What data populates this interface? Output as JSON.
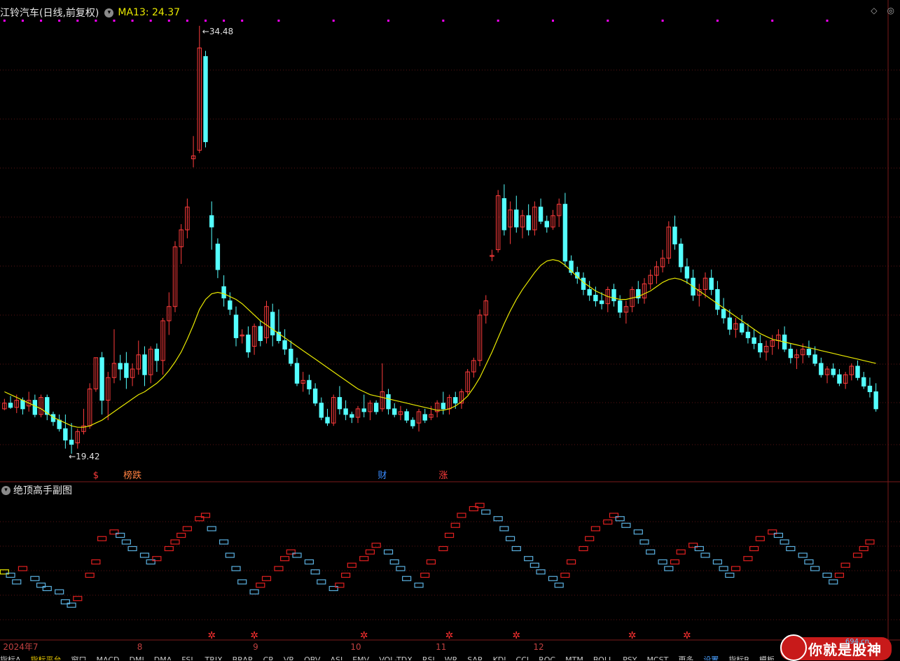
{
  "header": {
    "title": "江铃汽车(日线,前复权)",
    "ma_label": "MA13: 24.37"
  },
  "subpanel": {
    "title": "绝顶高手副图"
  },
  "toolbar": {
    "items": [
      "指标A",
      "指标平台",
      "窗口",
      "MACD",
      "DMI",
      "DMA",
      "FSL",
      "TRIX",
      "BRAR",
      "CR",
      "VR",
      "OBV",
      "ASI",
      "EMV",
      "VOL-TDX",
      "RSI",
      "WR",
      "SAR",
      "KDJ",
      "CCI",
      "ROC",
      "MTM",
      "BOLL",
      "PSY",
      "MCST",
      "更多",
      "设置",
      "指标B",
      "模板"
    ]
  },
  "watermark": {
    "brand": "你就是股神",
    "url": "694.cn"
  },
  "colors": {
    "up": "#ff3c3c",
    "down": "#54ffff",
    "ma": "#e8e800",
    "grid": "#5a1414",
    "sub_up": "#e02020",
    "sub_down": "#5bb0e0",
    "sub_mid": "#e8e800",
    "marker": "#ff00ff"
  },
  "chart_data": {
    "type": "candlestick",
    "title": "江铃汽车(日线,前复权)",
    "ma_label": "MA13",
    "ma_value": 24.37,
    "high_label": "34.48",
    "low_label": "19.42",
    "ylim": [
      19.0,
      34.6
    ],
    "x_labels": [
      "2024年7",
      "8",
      "9",
      "10",
      "11",
      "12"
    ],
    "event_tags": [
      {
        "label": "$",
        "index": 15,
        "color": "#ff3c3c"
      },
      {
        "label": "榜跌",
        "index": 21,
        "color": "#ff8040"
      },
      {
        "label": "财",
        "index": 62,
        "color": "#3a8cff"
      },
      {
        "label": "涨",
        "index": 72,
        "color": "#ff3c3c"
      }
    ],
    "ohlc": [
      [
        21.0,
        21.35,
        20.95,
        21.2
      ],
      [
        21.2,
        21.45,
        21.0,
        21.05
      ],
      [
        21.05,
        21.5,
        20.85,
        21.3
      ],
      [
        21.3,
        21.4,
        20.8,
        21.0
      ],
      [
        21.1,
        21.6,
        20.9,
        21.3
      ],
      [
        21.3,
        21.5,
        20.7,
        20.8
      ],
      [
        20.8,
        21.5,
        20.7,
        21.4
      ],
      [
        21.4,
        21.5,
        20.6,
        20.8
      ],
      [
        20.8,
        20.9,
        20.4,
        20.55
      ],
      [
        20.6,
        20.8,
        20.2,
        20.3
      ],
      [
        20.3,
        20.8,
        19.6,
        19.9
      ],
      [
        19.9,
        20.5,
        19.42,
        19.75
      ],
      [
        19.8,
        20.3,
        19.6,
        20.2
      ],
      [
        20.2,
        21.0,
        20.1,
        20.4
      ],
      [
        20.4,
        21.9,
        20.3,
        21.7
      ],
      [
        21.7,
        22.8,
        21.6,
        22.8
      ],
      [
        22.8,
        23.0,
        20.8,
        21.3
      ],
      [
        21.3,
        22.3,
        20.6,
        22.1
      ],
      [
        22.1,
        23.8,
        21.9,
        22.6
      ],
      [
        22.6,
        22.9,
        22.0,
        22.4
      ],
      [
        22.6,
        23.0,
        21.7,
        22.1
      ],
      [
        22.1,
        22.6,
        21.8,
        22.4
      ],
      [
        22.4,
        23.4,
        22.2,
        22.9
      ],
      [
        22.9,
        23.2,
        21.8,
        22.2
      ],
      [
        22.2,
        23.2,
        21.9,
        23.1
      ],
      [
        23.1,
        23.3,
        22.3,
        22.7
      ],
      [
        22.7,
        24.2,
        22.2,
        24.1
      ],
      [
        24.1,
        25.1,
        23.6,
        24.6
      ],
      [
        24.6,
        26.9,
        24.4,
        26.7
      ],
      [
        26.7,
        27.5,
        26.1,
        27.3
      ],
      [
        27.3,
        28.4,
        27.0,
        28.1
      ],
      [
        29.8,
        30.6,
        29.5,
        29.9
      ],
      [
        30.1,
        34.48,
        30.0,
        33.7
      ],
      [
        33.4,
        33.6,
        30.2,
        30.4
      ],
      [
        27.8,
        28.3,
        26.6,
        27.4
      ],
      [
        26.8,
        27.0,
        25.6,
        25.9
      ],
      [
        25.3,
        25.7,
        24.6,
        24.9
      ],
      [
        24.8,
        25.1,
        24.3,
        24.5
      ],
      [
        24.3,
        24.6,
        23.2,
        23.5
      ],
      [
        23.6,
        23.8,
        23.3,
        23.6
      ],
      [
        23.6,
        23.9,
        22.8,
        23.0
      ],
      [
        23.2,
        24.0,
        22.9,
        23.9
      ],
      [
        23.9,
        24.1,
        23.2,
        23.4
      ],
      [
        23.5,
        24.8,
        23.3,
        24.6
      ],
      [
        24.4,
        24.7,
        23.2,
        23.6
      ],
      [
        23.7,
        24.5,
        23.3,
        23.4
      ],
      [
        23.4,
        23.8,
        22.9,
        23.1
      ],
      [
        23.1,
        23.4,
        22.5,
        22.6
      ],
      [
        22.6,
        22.8,
        21.8,
        21.9
      ],
      [
        21.9,
        22.3,
        21.6,
        22.0
      ],
      [
        22.0,
        22.2,
        21.5,
        21.7
      ],
      [
        21.7,
        21.9,
        21.1,
        21.2
      ],
      [
        21.2,
        21.4,
        20.6,
        20.7
      ],
      [
        20.7,
        21.0,
        20.4,
        20.5
      ],
      [
        20.5,
        21.5,
        20.4,
        21.4
      ],
      [
        21.4,
        21.8,
        20.8,
        21.0
      ],
      [
        21.0,
        21.3,
        20.6,
        20.8
      ],
      [
        20.8,
        20.9,
        20.5,
        20.7
      ],
      [
        20.7,
        21.1,
        20.5,
        21.0
      ],
      [
        21.0,
        21.5,
        20.7,
        20.9
      ],
      [
        20.9,
        21.3,
        20.6,
        21.2
      ],
      [
        21.2,
        21.3,
        20.8,
        20.9
      ],
      [
        21.0,
        22.6,
        20.9,
        21.6
      ],
      [
        21.5,
        21.7,
        20.8,
        21.0
      ],
      [
        21.0,
        21.2,
        20.7,
        20.8
      ],
      [
        20.8,
        21.1,
        20.6,
        20.9
      ],
      [
        20.9,
        21.0,
        20.5,
        20.6
      ],
      [
        20.6,
        20.7,
        20.3,
        20.4
      ],
      [
        20.5,
        21.0,
        20.2,
        20.9
      ],
      [
        20.8,
        21.0,
        20.5,
        20.6
      ],
      [
        20.7,
        21.1,
        20.6,
        20.8
      ],
      [
        20.9,
        21.3,
        20.7,
        21.2
      ],
      [
        21.2,
        21.6,
        20.8,
        21.0
      ],
      [
        21.0,
        21.5,
        20.8,
        21.4
      ],
      [
        21.4,
        21.6,
        21.0,
        21.2
      ],
      [
        21.2,
        21.7,
        21.0,
        21.6
      ],
      [
        21.6,
        22.4,
        21.5,
        22.3
      ],
      [
        22.3,
        22.8,
        22.1,
        22.7
      ],
      [
        22.7,
        24.5,
        22.5,
        24.3
      ],
      [
        24.3,
        25.0,
        24.0,
        24.8
      ],
      [
        26.4,
        26.6,
        26.2,
        26.4
      ],
      [
        26.6,
        28.7,
        26.5,
        28.5
      ],
      [
        28.4,
        28.9,
        27.1,
        27.3
      ],
      [
        27.4,
        28.3,
        26.8,
        28.0
      ],
      [
        28.0,
        28.5,
        27.2,
        27.4
      ],
      [
        27.4,
        28.0,
        27.0,
        27.8
      ],
      [
        27.8,
        28.2,
        27.1,
        27.3
      ],
      [
        27.3,
        28.3,
        27.1,
        28.1
      ],
      [
        28.1,
        28.4,
        27.5,
        27.6
      ],
      [
        27.6,
        27.8,
        27.2,
        27.4
      ],
      [
        27.4,
        28.0,
        27.3,
        27.8
      ],
      [
        27.8,
        28.4,
        27.4,
        28.2
      ],
      [
        28.2,
        28.6,
        26.0,
        26.2
      ],
      [
        26.2,
        26.4,
        25.7,
        25.8
      ],
      [
        25.8,
        26.0,
        25.4,
        25.6
      ],
      [
        25.6,
        25.8,
        25.0,
        25.2
      ],
      [
        25.2,
        25.5,
        24.8,
        25.0
      ],
      [
        25.0,
        25.3,
        24.6,
        24.8
      ],
      [
        24.8,
        25.1,
        24.5,
        24.7
      ],
      [
        24.7,
        25.3,
        24.4,
        25.2
      ],
      [
        25.2,
        25.4,
        24.6,
        24.8
      ],
      [
        24.8,
        25.0,
        24.2,
        24.4
      ],
      [
        24.4,
        24.8,
        24.0,
        24.6
      ],
      [
        24.6,
        25.3,
        24.4,
        25.2
      ],
      [
        25.2,
        25.5,
        24.7,
        24.9
      ],
      [
        24.9,
        25.6,
        24.7,
        25.4
      ],
      [
        25.4,
        25.9,
        25.2,
        25.7
      ],
      [
        25.7,
        26.2,
        25.4,
        26.0
      ],
      [
        26.0,
        26.6,
        25.8,
        26.3
      ],
      [
        26.3,
        27.6,
        26.1,
        27.4
      ],
      [
        27.4,
        27.8,
        26.6,
        26.8
      ],
      [
        26.8,
        27.0,
        25.8,
        26.0
      ],
      [
        26.0,
        26.3,
        25.4,
        25.6
      ],
      [
        25.6,
        25.9,
        24.8,
        25.0
      ],
      [
        25.0,
        25.4,
        24.6,
        25.2
      ],
      [
        25.2,
        25.8,
        24.9,
        25.6
      ],
      [
        25.6,
        25.9,
        25.0,
        25.2
      ],
      [
        25.2,
        25.5,
        24.3,
        24.5
      ],
      [
        24.5,
        24.9,
        24.0,
        24.2
      ],
      [
        24.2,
        24.5,
        23.6,
        23.8
      ],
      [
        23.8,
        24.2,
        23.5,
        24.0
      ],
      [
        24.0,
        24.3,
        23.6,
        23.7
      ],
      [
        23.7,
        24.0,
        23.3,
        23.5
      ],
      [
        23.5,
        23.8,
        23.1,
        23.3
      ],
      [
        23.3,
        23.6,
        22.8,
        23.0
      ],
      [
        23.0,
        23.4,
        22.7,
        23.2
      ],
      [
        23.2,
        23.6,
        22.9,
        23.4
      ],
      [
        23.4,
        23.8,
        23.1,
        23.6
      ],
      [
        23.6,
        23.9,
        23.0,
        23.1
      ],
      [
        23.1,
        23.3,
        22.6,
        22.8
      ],
      [
        22.8,
        23.1,
        22.4,
        22.9
      ],
      [
        22.9,
        23.3,
        22.6,
        23.1
      ],
      [
        23.1,
        23.4,
        22.8,
        22.9
      ],
      [
        22.9,
        23.2,
        22.5,
        22.6
      ],
      [
        22.6,
        22.8,
        22.1,
        22.2
      ],
      [
        22.2,
        22.5,
        21.9,
        22.4
      ],
      [
        22.4,
        22.6,
        22.1,
        22.2
      ],
      [
        22.2,
        22.4,
        21.8,
        21.9
      ],
      [
        21.9,
        22.3,
        21.7,
        22.2
      ],
      [
        22.2,
        22.6,
        22.0,
        22.5
      ],
      [
        22.5,
        22.7,
        22.0,
        22.1
      ],
      [
        22.1,
        22.3,
        21.7,
        21.8
      ],
      [
        21.8,
        22.1,
        21.4,
        21.6
      ],
      [
        21.6,
        21.9,
        20.9,
        21.0
      ]
    ],
    "ma13": [
      21.6,
      21.5,
      21.4,
      21.3,
      21.2,
      21.1,
      21.0,
      20.85,
      20.7,
      20.6,
      20.5,
      20.4,
      20.35,
      20.35,
      20.4,
      20.5,
      20.6,
      20.75,
      20.9,
      21.05,
      21.2,
      21.35,
      21.5,
      21.6,
      21.75,
      21.9,
      22.1,
      22.35,
      22.65,
      23.0,
      23.45,
      23.95,
      24.5,
      24.85,
      25.05,
      25.1,
      25.05,
      24.95,
      24.85,
      24.7,
      24.5,
      24.3,
      24.1,
      23.95,
      23.8,
      23.65,
      23.5,
      23.35,
      23.2,
      23.05,
      22.9,
      22.75,
      22.6,
      22.45,
      22.3,
      22.15,
      22.0,
      21.85,
      21.7,
      21.6,
      21.5,
      21.45,
      21.4,
      21.35,
      21.3,
      21.25,
      21.2,
      21.15,
      21.1,
      21.05,
      21.0,
      20.95,
      20.95,
      21.0,
      21.1,
      21.25,
      21.45,
      21.75,
      22.1,
      22.55,
      23.0,
      23.5,
      24.0,
      24.45,
      24.85,
      25.2,
      25.5,
      25.8,
      26.05,
      26.2,
      26.25,
      26.2,
      26.05,
      25.85,
      25.65,
      25.45,
      25.3,
      25.15,
      25.05,
      24.95,
      24.9,
      24.85,
      24.85,
      24.9,
      24.95,
      25.05,
      25.15,
      25.3,
      25.45,
      25.55,
      25.6,
      25.55,
      25.45,
      25.3,
      25.15,
      25.0,
      24.85,
      24.7,
      24.55,
      24.4,
      24.25,
      24.1,
      23.95,
      23.8,
      23.65,
      23.55,
      23.45,
      23.4,
      23.35,
      23.3,
      23.25,
      23.2,
      23.15,
      23.1,
      23.05,
      23.0,
      22.95,
      22.9,
      22.85,
      22.8,
      22.75,
      22.7,
      22.65,
      22.6
    ],
    "sub_values": [
      38,
      36,
      32,
      40,
      34,
      30,
      28,
      26,
      20,
      18,
      22,
      36,
      44,
      58,
      62,
      60,
      56,
      52,
      48,
      44,
      46,
      52,
      56,
      60,
      64,
      70,
      72,
      64,
      56,
      48,
      40,
      32,
      26,
      30,
      34,
      40,
      46,
      50,
      48,
      44,
      38,
      32,
      28,
      30,
      36,
      42,
      46,
      50,
      54,
      50,
      44,
      40,
      34,
      30,
      36,
      44,
      52,
      60,
      66,
      72,
      76,
      78,
      74,
      70,
      64,
      58,
      52,
      46,
      42,
      38,
      34,
      30,
      36,
      44,
      52,
      58,
      64,
      68,
      72,
      70,
      66,
      62,
      56,
      50,
      44,
      40,
      44,
      50,
      54,
      52,
      48,
      44,
      40,
      36,
      40,
      46,
      52,
      58,
      62,
      60,
      56,
      52,
      48,
      44,
      40,
      36,
      32,
      36,
      42,
      48,
      52,
      56
    ],
    "sub_marker_points": [
      34,
      41,
      59,
      73,
      84,
      103,
      112
    ]
  }
}
